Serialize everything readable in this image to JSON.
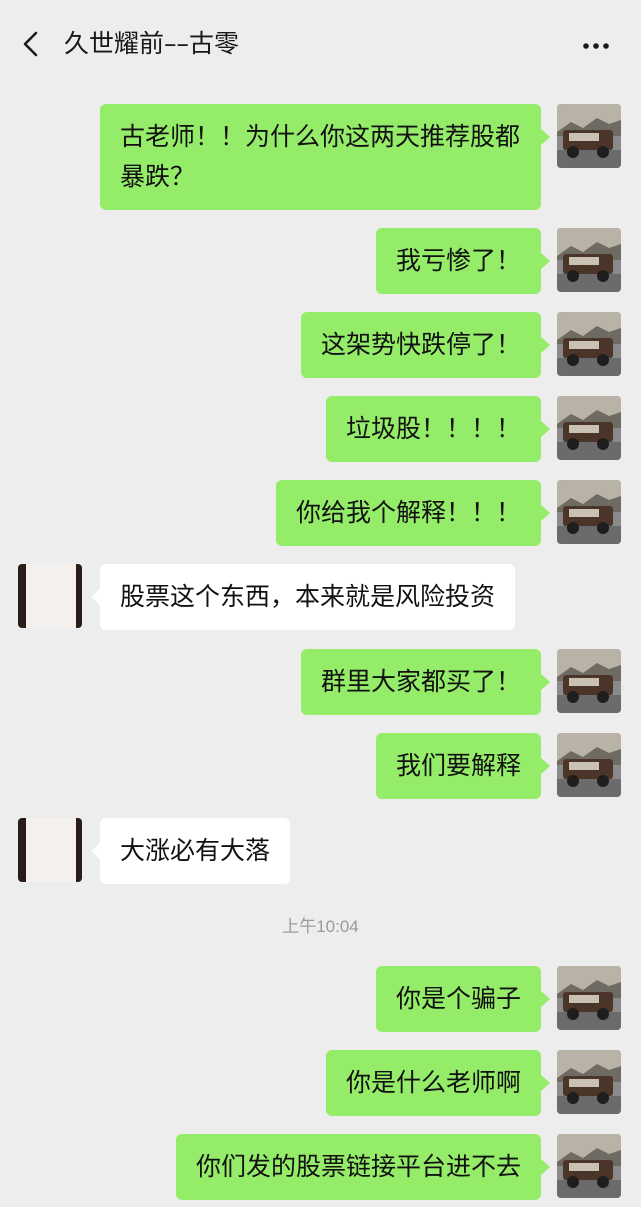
{
  "header": {
    "title": "久世耀前––古零",
    "back_icon": "chevron-left-icon",
    "more_icon": "more-dots-icon"
  },
  "messages": [
    {
      "side": "right",
      "text": "古老师！！为什么你这两天推荐股都暴跌？"
    },
    {
      "side": "right",
      "text": "我亏惨了！"
    },
    {
      "side": "right",
      "text": "这架势快跌停了！"
    },
    {
      "side": "right",
      "text": "垃圾股！！！！"
    },
    {
      "side": "right",
      "text": "你给我个解释！！！"
    },
    {
      "side": "left",
      "text": "股票这个东西，本来就是风险投资"
    },
    {
      "side": "right",
      "text": "群里大家都买了！"
    },
    {
      "side": "right",
      "text": "我们要解释"
    },
    {
      "side": "left",
      "text": "大涨必有大落"
    },
    {
      "side": "right",
      "text": "你是个骗子"
    },
    {
      "side": "right",
      "text": "你是什么老师啊"
    },
    {
      "side": "right",
      "text": "你们发的股票链接平台进不去"
    }
  ],
  "timestamp": "上午10:04",
  "colors": {
    "background": "#ededed",
    "sent_bubble": "#95ec69",
    "received_bubble": "#ffffff"
  }
}
